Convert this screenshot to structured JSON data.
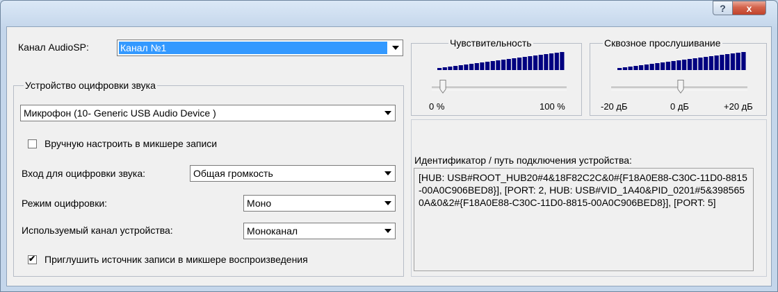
{
  "titlebar": {
    "help_label": "?",
    "close_label": "x"
  },
  "channel": {
    "label": "Канал AudioSP:",
    "value": "Канал №1"
  },
  "device_group": {
    "legend": "Устройство оцифровки звука",
    "device_value": "Микрофон (10- Generic USB Audio Device   )",
    "manual_mixer_label": "Вручную настроить в микшере записи",
    "manual_mixer_checked": false,
    "input_label": "Вход для оцифровки звука:",
    "input_value": "Общая громкость",
    "mode_label": "Режим оцифровки:",
    "mode_value": "Моно",
    "channel_label": "Используемый канал устройства:",
    "channel_value": "Моноканал",
    "mute_label": "Приглушить источник записи в микшере воспроизведения",
    "mute_checked": true
  },
  "sensitivity": {
    "legend": "Чувствительность",
    "min_label": "0 %",
    "max_label": "100 %",
    "level": 0.05
  },
  "passthrough": {
    "legend": "Сквозное прослушивание",
    "min_label": "-20 дБ",
    "mid_label": "0 дБ",
    "max_label": "+20 дБ",
    "level": 0.5
  },
  "device_id": {
    "label": "Идентификатор / путь подключения устройства:",
    "value": "[HUB: USB#ROOT_HUB20#4&18F82C2C&0#{F18A0E88-C30C-11D0-8815-00A0C906BED8}], [PORT: 2, HUB: USB#VID_1A40&PID_0201#5&3985650A&0&2#{F18A0E88-C30C-11D0-8815-00A0C906BED8}], [PORT: 5]"
  },
  "colors": {
    "meter_fill": "#000080",
    "selection": "#3399ff",
    "close_red": "#c0422a"
  },
  "icons": {
    "dropdown": "chevron-down-icon",
    "help": "question-icon",
    "close": "close-icon"
  }
}
